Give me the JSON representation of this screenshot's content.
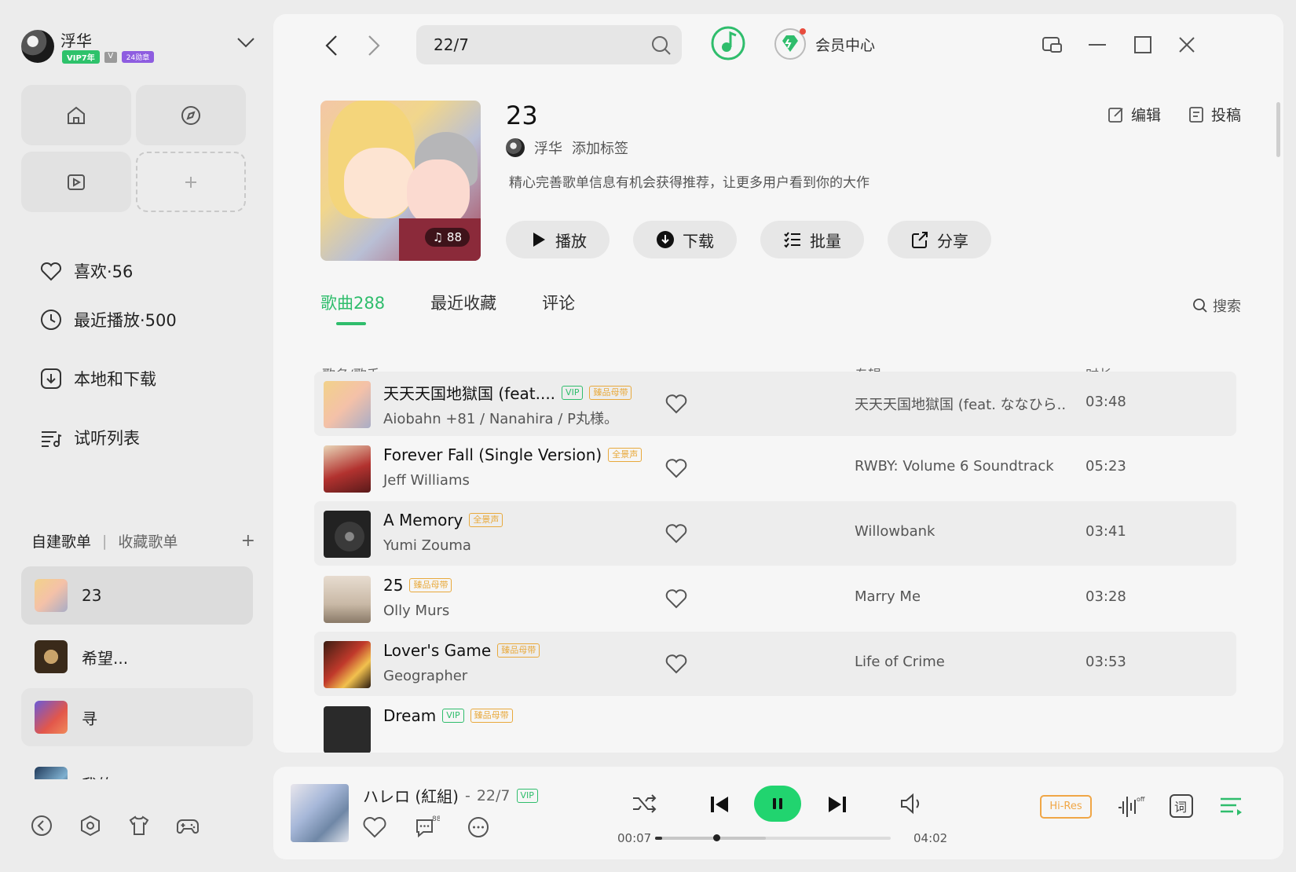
{
  "user": {
    "name": "浮华",
    "vip_badge": "VIP7年",
    "v_badge": "V",
    "level_badge": "24勋章"
  },
  "nav": {
    "items": [
      {
        "label": "喜欢·56",
        "icon": "heart-icon"
      },
      {
        "label": "最近播放·500",
        "icon": "clock-icon"
      },
      {
        "label": "本地和下载",
        "icon": "download-icon"
      },
      {
        "label": "试听列表",
        "icon": "queue-icon"
      }
    ]
  },
  "playlists": {
    "tab_created": "自建歌单",
    "separator": "|",
    "tab_collected": "收藏歌单",
    "add": "+",
    "items": [
      {
        "name": "23",
        "active": true
      },
      {
        "name": "希望..."
      },
      {
        "name": "寻"
      },
      {
        "name": "我的"
      }
    ]
  },
  "search": {
    "value": "22/7",
    "placeholder": ""
  },
  "vip_center": "会员中心",
  "playlist": {
    "title": "23",
    "owner": "浮华",
    "add_tag": "添加标签",
    "description": "精心完善歌单信息有机会获得推荐，让更多用户看到你的大作",
    "play_count": "88",
    "edit": "编辑",
    "submit": "投稿"
  },
  "buttons": {
    "play": "播放",
    "download": "下载",
    "batch": "批量",
    "share": "分享"
  },
  "tabs": {
    "songs": "歌曲288",
    "recent_fav": "最近收藏",
    "comments": "评论",
    "search": "搜索"
  },
  "table": {
    "col_song": "歌名/歌手",
    "col_album": "专辑",
    "col_duration": "时长",
    "rows": [
      {
        "title": "天天天国地獄国 (feat....",
        "tags": [
          "VIP",
          "臻品母带"
        ],
        "artist": "Aiobahn +81 / Nanahira / P丸様。",
        "album": "天天天国地獄国 (feat. ななひら...",
        "duration": "03:48"
      },
      {
        "title": "Forever Fall (Single Version)",
        "tags": [
          "全景声"
        ],
        "artist": "Jeff Williams",
        "album": "RWBY: Volume 6 Soundtrack",
        "duration": "05:23"
      },
      {
        "title": "A Memory",
        "tags": [
          "全景声"
        ],
        "artist": "Yumi Zouma",
        "album": "Willowbank",
        "duration": "03:41"
      },
      {
        "title": "25",
        "tags": [
          "臻品母带"
        ],
        "artist": "Olly Murs",
        "album": "Marry Me",
        "duration": "03:28"
      },
      {
        "title": "Lover's Game",
        "tags": [
          "臻品母带"
        ],
        "artist": "Geographer",
        "album": "Life of Crime",
        "duration": "03:53"
      },
      {
        "title": "Dream",
        "tags": [
          "VIP",
          "臻品母带"
        ],
        "artist": "",
        "album": "",
        "duration": ""
      }
    ]
  },
  "player": {
    "title": "ハレロ (紅組)",
    "separator": "-",
    "artist": "22/7",
    "vip_tag": "VIP",
    "comment_count": "88",
    "elapsed": "00:07",
    "total": "04:02",
    "progress": 0.03,
    "buffered": 0.47,
    "hires": "Hi-Res"
  },
  "colors": {
    "accent": "#2fbd6c",
    "play_button": "#21d46f",
    "quality_tag": "#e8a93c"
  }
}
